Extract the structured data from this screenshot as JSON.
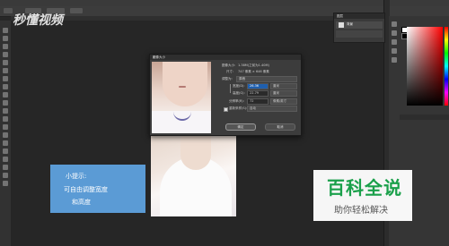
{
  "watermark": "秒懂视频",
  "layers_panel": {
    "title": "图层",
    "layer_name": "背景"
  },
  "dialog": {
    "title": "图像大小",
    "close": "×",
    "image_size_label": "图像大小:",
    "image_size_value": "1.38M(之前为1.40M)",
    "dimensions_label": "尺寸:",
    "dimensions_value": "747 像素 × 646 像素",
    "fit_label": "调整为:",
    "fit_value": "原稿",
    "width_label": "宽度(D):",
    "width_value": "26.36",
    "width_unit": "厘米",
    "height_label": "高度(G):",
    "height_value": "22.79",
    "height_unit": "厘米",
    "resolution_label": "分辨率(R):",
    "resolution_value": "72",
    "resolution_unit": "像素/英寸",
    "resample_label": "重新采样(S):",
    "resample_value": "自动",
    "ok": "确定",
    "cancel": "取消"
  },
  "tip": {
    "line1": "小提示:",
    "line2": "可自由调整宽度",
    "line3": "和高度"
  },
  "brand": {
    "title": "百科全说",
    "subtitle": "助你轻松解决"
  },
  "colors": {
    "tip_box": "#5b9bd5",
    "brand_green": "#1aa04a",
    "canvas": "#262626"
  }
}
